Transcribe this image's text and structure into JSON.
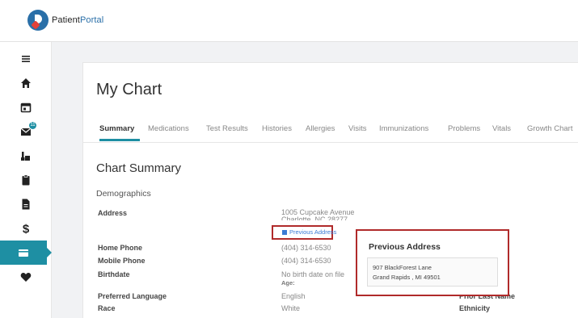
{
  "brand": {
    "name_part1": "Patient",
    "name_part2": "Portal"
  },
  "sidebar": {
    "items": [
      {
        "icon": "menu-icon"
      },
      {
        "icon": "home-icon"
      },
      {
        "icon": "calendar-icon"
      },
      {
        "icon": "mail-icon",
        "badge": "11"
      },
      {
        "icon": "lab-icon"
      },
      {
        "icon": "clipboard-icon"
      },
      {
        "icon": "document-icon"
      },
      {
        "icon": "dollar-icon"
      },
      {
        "icon": "card-icon",
        "active": true
      },
      {
        "icon": "heart-icon"
      }
    ],
    "accent_color": "#1e8fa3"
  },
  "page": {
    "title": "My Chart"
  },
  "tabs": [
    "Summary",
    "Medications",
    "Test Results",
    "Histories",
    "Allergies",
    "Visits",
    "Immunizations",
    "Problems",
    "Vitals",
    "Growth Chart"
  ],
  "summary": {
    "title": "Chart Summary",
    "section": "Demographics",
    "address_label": "Address",
    "address_line1": "1005 Cupcake Avenue",
    "address_line2": "Charlotte, NC 28277",
    "previous_address_link": "Previous Address",
    "home_phone_label": "Home Phone",
    "home_phone": "(404) 314-6530",
    "mobile_phone_label": "Mobile Phone",
    "mobile_phone": "(404) 314-6530",
    "birthdate_label": "Birthdate",
    "birthdate": "No birth date on file",
    "age_label": "Age:",
    "language_label": "Preferred Language",
    "language": "English",
    "race_label": "Race",
    "race": "White",
    "prior_last_name_label": "Prior Last Name",
    "ethnicity_label": "Ethnicity"
  },
  "popup": {
    "title": "Previous Address",
    "line1": "907 BlackForest Lane",
    "line2": "Grand Rapids , MI 49501"
  }
}
